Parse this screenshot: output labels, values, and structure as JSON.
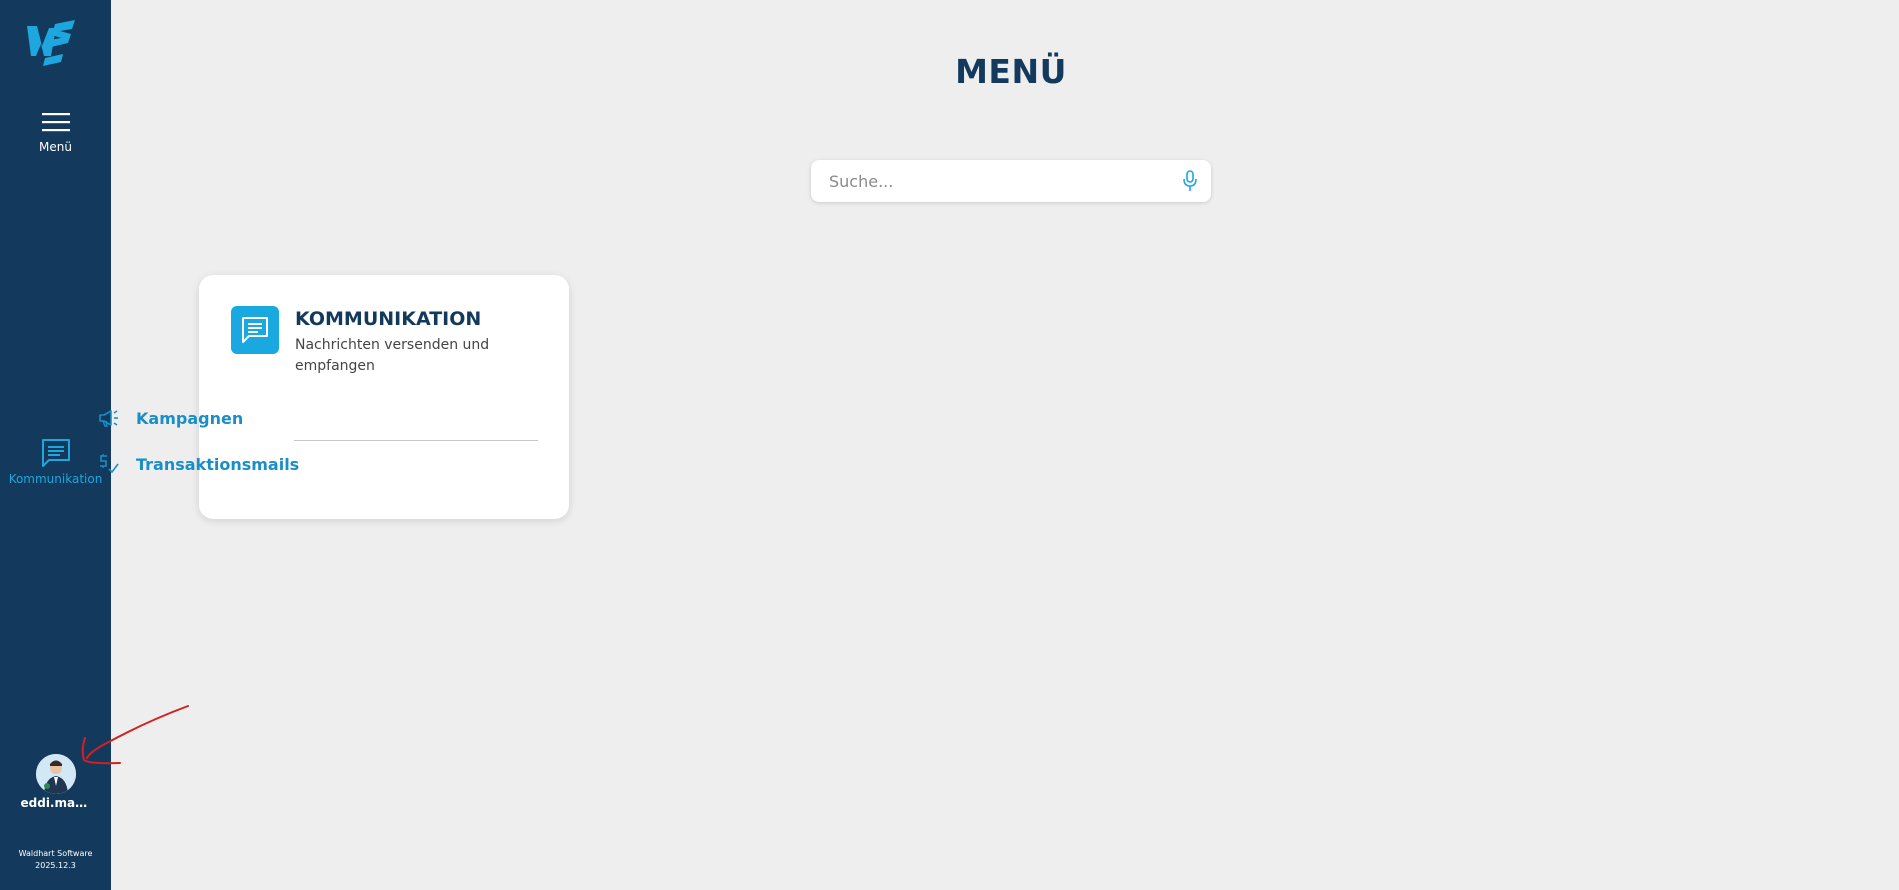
{
  "sidebar": {
    "logo": "ws-logo-icon",
    "menu_label": "Menü",
    "kommunikation_label": "Kommunikation",
    "user_name": "eddi.mail...",
    "version_line1": "Waldhart Software",
    "version_line2": "2025.12.3"
  },
  "main": {
    "title": "MENÜ",
    "search_placeholder": "Suche...",
    "card": {
      "title": "KOMMUNIKATION",
      "subtitle": "Nachrichten versenden und empfangen",
      "links": [
        {
          "label": "Kampagnen",
          "icon": "megaphone-icon"
        },
        {
          "label": "Transaktionsmails",
          "icon": "transaction-check-icon"
        }
      ]
    }
  },
  "colors": {
    "sidebar_bg": "#133a5c",
    "accent": "#19a9e0",
    "link": "#1a8fc7",
    "page_bg": "#eeeeee",
    "annotation": "#d42020"
  }
}
